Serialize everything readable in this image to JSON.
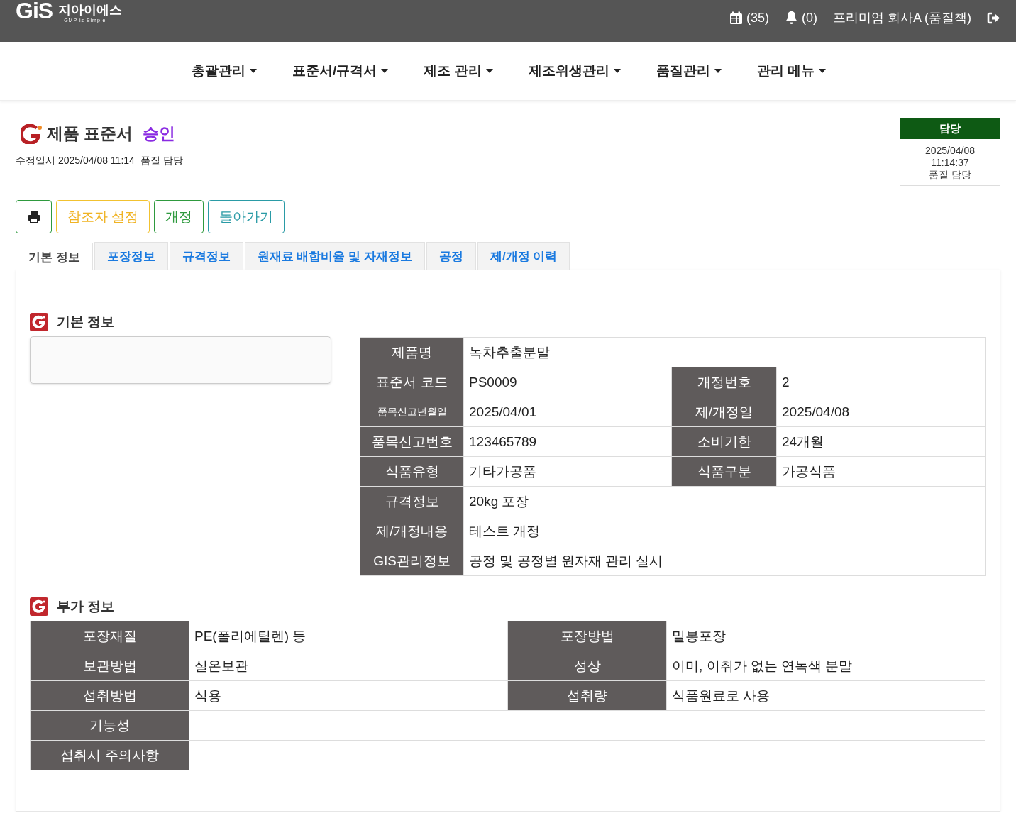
{
  "header": {
    "logo": {
      "mark": "GiS",
      "name": "지아이에스",
      "tagline": "GMP is Simple"
    },
    "calendar_count": "(35)",
    "notification_count": "(0)",
    "user": "프리미엄 회사A (품질책)"
  },
  "nav": [
    "총괄관리",
    "표준서/규격서",
    "제조 관리",
    "제조위생관리",
    "품질관리",
    "관리 메뉴"
  ],
  "page": {
    "title": "제품 표준서",
    "status": "승인",
    "modified": "수정일시 2025/04/08 11:14  품질 담당"
  },
  "approval": {
    "heading": "담당",
    "date": "2025/04/08",
    "time": "11:14:37",
    "person": "품질 담당"
  },
  "buttons": [
    {
      "kind": "print"
    },
    {
      "kind": "warning",
      "label": "참조자 설정"
    },
    {
      "kind": "success",
      "label": "개정"
    },
    {
      "kind": "info",
      "label": "돌아가기"
    }
  ],
  "tabs": [
    {
      "label": "기본 정보",
      "selected": true
    },
    {
      "label": "포장정보",
      "selected": false
    },
    {
      "label": "규격정보",
      "selected": false
    },
    {
      "label": "원재료 배합비율 및 자재정보",
      "selected": false
    },
    {
      "label": "공정",
      "selected": false
    },
    {
      "label": "제/개정 이력",
      "selected": false
    }
  ],
  "basic_info": {
    "heading": "기본 정보",
    "rows": [
      {
        "cells": [
          {
            "label": "제품명",
            "value": "녹차추출분말"
          }
        ]
      },
      {
        "cells": [
          {
            "label": "표준서 코드",
            "value": "PS0009"
          },
          {
            "label": "개정번호",
            "value": "2"
          }
        ]
      },
      {
        "cells": [
          {
            "label": "품목신고년월일",
            "value": "2025/04/01",
            "compact_label": true
          },
          {
            "label": "제/개정일",
            "value": "2025/04/08"
          }
        ]
      },
      {
        "cells": [
          {
            "label": "품목신고번호",
            "value": "123465789"
          },
          {
            "label": "소비기한",
            "value": "24개월"
          }
        ]
      },
      {
        "cells": [
          {
            "label": "식품유형",
            "value": "기타가공품"
          },
          {
            "label": "식품구분",
            "value": "가공식품"
          }
        ]
      },
      {
        "cells": [
          {
            "label": "규격정보",
            "value": "20kg 포장"
          }
        ]
      },
      {
        "cells": [
          {
            "label": "제/개정내용",
            "value": "테스트 개정"
          }
        ]
      },
      {
        "cells": [
          {
            "label": "GIS관리정보",
            "value": "공정 및 공정별 원자재 관리 실시"
          }
        ]
      }
    ]
  },
  "additional_info": {
    "heading": "부가 정보",
    "rows": [
      {
        "cells": [
          {
            "label": "포장재질",
            "value": "PE(폴리에틸렌) 등"
          },
          {
            "label": "포장방법",
            "value": "밀봉포장"
          }
        ]
      },
      {
        "cells": [
          {
            "label": "보관방법",
            "value": "실온보관"
          },
          {
            "label": "성상",
            "value": "이미, 이취가 없는 연녹색 분말"
          }
        ]
      },
      {
        "cells": [
          {
            "label": "섭취방법",
            "value": "식용"
          },
          {
            "label": "섭취량",
            "value": "식품원료로 사용"
          }
        ]
      },
      {
        "cells": [
          {
            "label": "기능성"
          }
        ]
      },
      {
        "cells": [
          {
            "label": "섭취시 주의사항"
          }
        ]
      }
    ]
  }
}
